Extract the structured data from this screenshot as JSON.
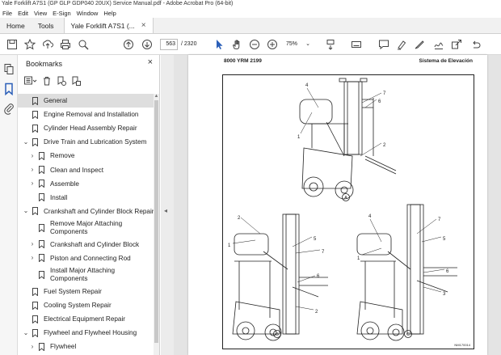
{
  "window": {
    "title": "Yale Forklift A7S1 (GP GLP GDP040 20UX) Service Manual.pdf - Adobe Acrobat Pro (64-bit)"
  },
  "menu": [
    "File",
    "Edit",
    "View",
    "E-Sign",
    "Window",
    "Help"
  ],
  "tabs": {
    "home": "Home",
    "tools": "Tools",
    "document": "Yale Forklift A7S1 (..."
  },
  "toolbar": {
    "current_page": "563",
    "total_pages": "/ 2320",
    "zoom": "75%"
  },
  "bookmarks_panel": {
    "title": "Bookmarks",
    "items": [
      {
        "label": "General",
        "level": 0,
        "expander": false,
        "selected": true
      },
      {
        "label": "Engine Removal and Installation",
        "level": 0,
        "expander": false
      },
      {
        "label": "Cylinder Head Assembly Repair",
        "level": 0,
        "expander": false
      },
      {
        "label": "Drive Train and Lubrication System",
        "level": 0,
        "expander": true,
        "expanded": true
      },
      {
        "label": "Remove",
        "level": 1,
        "expander": true
      },
      {
        "label": "Clean and Inspect",
        "level": 1,
        "expander": true
      },
      {
        "label": "Assemble",
        "level": 1,
        "expander": true
      },
      {
        "label": "Install",
        "level": 1,
        "expander": false
      },
      {
        "label": "Crankshaft and Cylinder Block Repair",
        "level": 0,
        "expander": true,
        "expanded": true
      },
      {
        "label": "Remove Major Attaching Components",
        "level": 1,
        "expander": false,
        "two_line": true
      },
      {
        "label": "Crankshaft and Cylinder Block",
        "level": 1,
        "expander": true
      },
      {
        "label": "Piston and Connecting Rod",
        "level": 1,
        "expander": true
      },
      {
        "label": "Install Major Attaching Components",
        "level": 1,
        "expander": false,
        "two_line": true
      },
      {
        "label": "Fuel System Repair",
        "level": 0,
        "expander": false
      },
      {
        "label": "Cooling System Repair",
        "level": 0,
        "expander": false
      },
      {
        "label": "Electrical Equipment Repair",
        "level": 0,
        "expander": false
      },
      {
        "label": "Flywheel and Flywheel Housing",
        "level": 0,
        "expander": true,
        "expanded": true
      },
      {
        "label": "Flywheel",
        "level": 1,
        "expander": true
      }
    ]
  },
  "document": {
    "header_left": "8000 YRM 2199",
    "header_right": "Sistema de Elevación",
    "figure_code": "NM170014",
    "panel_a": "A",
    "panel_b": "B",
    "panel_c": "C"
  },
  "colors": {
    "selection": "#dedede",
    "doc_background": "#e4e4e4",
    "tab_bar": "#f1f1f1"
  }
}
